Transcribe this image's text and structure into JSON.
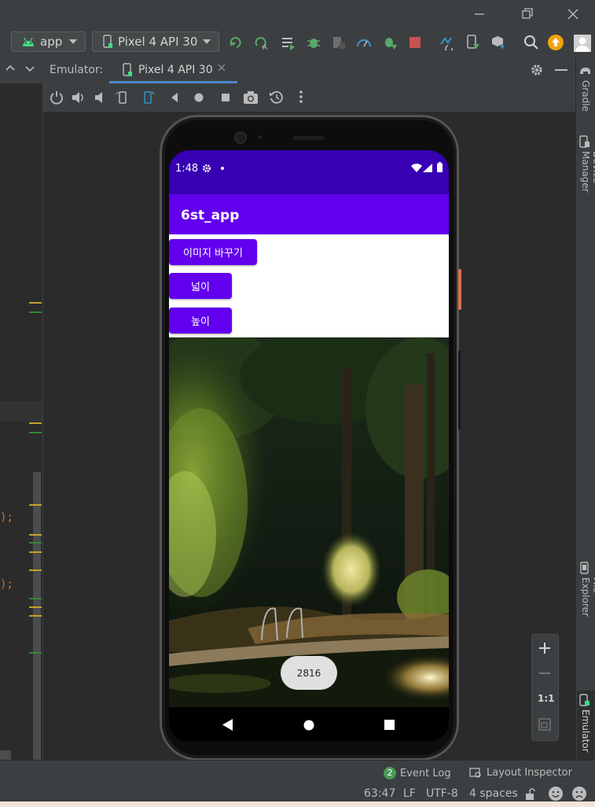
{
  "toolbar": {
    "run_config": "app",
    "device": "Pixel 4 API 30"
  },
  "emulator": {
    "panel_label": "Emulator:",
    "tab_label": "Pixel 4 API 30"
  },
  "right_sidebar": {
    "gradle": "Gradle",
    "device_manager": "Device Manager",
    "device_file_explorer": "Device File Explorer",
    "emulator": "Emulator"
  },
  "editor": {
    "line1_tail": ");",
    "line2_tail": ");"
  },
  "phone": {
    "status_time": "1:48",
    "app_title": "6st_app",
    "buttons": [
      "이미지 바꾸기",
      "넓이",
      "높이"
    ],
    "toast": "2816"
  },
  "zoom": {
    "one_to_one": "1:1"
  },
  "statusbar": {
    "event_log_count": "2",
    "event_log": "Event Log",
    "layout_inspector": "Layout Inspector",
    "cursor": "63:47",
    "line_sep": "LF",
    "encoding": "UTF-8",
    "indent": "4 spaces"
  },
  "colors": {
    "primary": "#6200ee",
    "primary_dark": "#3700b3",
    "ide_bg": "#3c3f41",
    "editor_bg": "#2b2b2b"
  }
}
